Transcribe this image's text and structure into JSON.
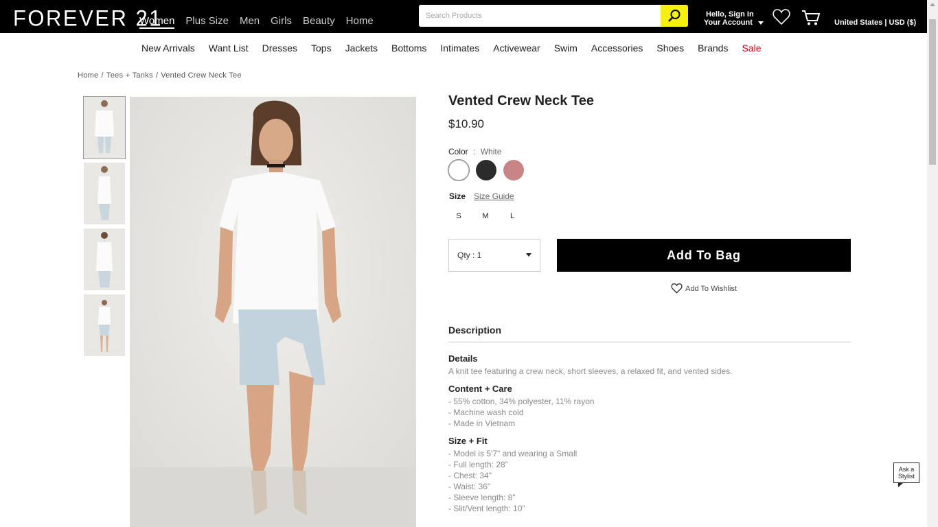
{
  "header": {
    "logo": "FOREVER 21",
    "nav": [
      "Women",
      "Plus Size",
      "Men",
      "Girls",
      "Beauty",
      "Home"
    ],
    "active_nav": "Women",
    "search_placeholder": "Search Products",
    "account_line1": "Hello, Sign In",
    "account_line2": "Your Account",
    "locale": "United States | USD ($)"
  },
  "subnav": [
    "New Arrivals",
    "Want List",
    "Dresses",
    "Tops",
    "Jackets",
    "Bottoms",
    "Intimates",
    "Activewear",
    "Swim",
    "Accessories",
    "Shoes",
    "Brands",
    "Sale"
  ],
  "breadcrumb": [
    "Home",
    "Tees + Tanks",
    "Vented Crew Neck Tee"
  ],
  "product": {
    "title": "Vented Crew Neck Tee",
    "price": "$10.90",
    "color_label": "Color",
    "color_sep": ":",
    "color_value": "White",
    "swatches": [
      {
        "name": "white",
        "color": "#ffffff"
      },
      {
        "name": "black",
        "color": "#2b2b2b"
      },
      {
        "name": "rose",
        "color": "#c98585"
      }
    ],
    "size_label": "Size",
    "size_guide": "Size Guide",
    "sizes": [
      "S",
      "M",
      "L"
    ],
    "qty": "Qty : 1",
    "add_to_bag": "Add To Bag",
    "wishlist": "Add To Wishlist"
  },
  "description": {
    "heading": "Description",
    "details_h": "Details",
    "details_t": "A knit tee featuring a crew neck, short sleeves, a relaxed fit, and vented sides.",
    "care_h": "Content + Care",
    "care": [
      "- 55% cotton, 34% polyester, 11% rayon",
      "- Machine wash cold",
      "- Made in Vietnam"
    ],
    "fit_h": "Size + Fit",
    "fit": [
      "- Model is 5'7\" and wearing a Small",
      "- Full length: 28\"",
      "- Chest: 34\"",
      "- Waist: 36\"",
      "- Sleeve length: 8\"",
      "- Slit/Vent length: 10\""
    ]
  },
  "stylist": {
    "line1": "Ask a",
    "line2": "Stylist"
  },
  "colors": {
    "topbar": "#000000",
    "search_button": "#f5f00f",
    "sale": "#d0021b"
  }
}
